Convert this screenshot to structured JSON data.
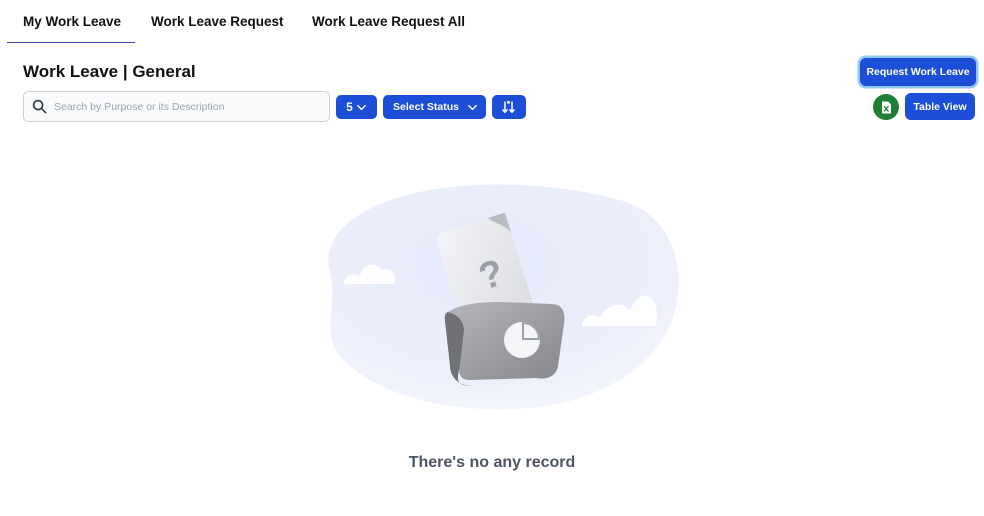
{
  "tabs": [
    {
      "label": "My Work Leave",
      "active": true
    },
    {
      "label": "Work Leave Request",
      "active": false
    },
    {
      "label": "Work Leave Request All",
      "active": false
    }
  ],
  "header": {
    "title": "Work Leave | General",
    "request_button": "Request Work Leave"
  },
  "toolbar": {
    "search_placeholder": "Search by Purpose or its Description",
    "search_value": "",
    "page_size": "5",
    "status_select": "Select Status",
    "table_view_button": "Table View",
    "icons": {
      "search": "search-icon",
      "page_size_chevron": "chevron-down-icon",
      "status_chevron": "chevron-down-icon",
      "sort": "sort-icon",
      "excel": "excel-file-icon"
    }
  },
  "empty_state": {
    "message": "There's no any record"
  },
  "colors": {
    "primary": "#1d4ed8",
    "excel": "#1e7e34",
    "tab_underline": "#3b4aa8",
    "empty_text": "#4b5563"
  }
}
